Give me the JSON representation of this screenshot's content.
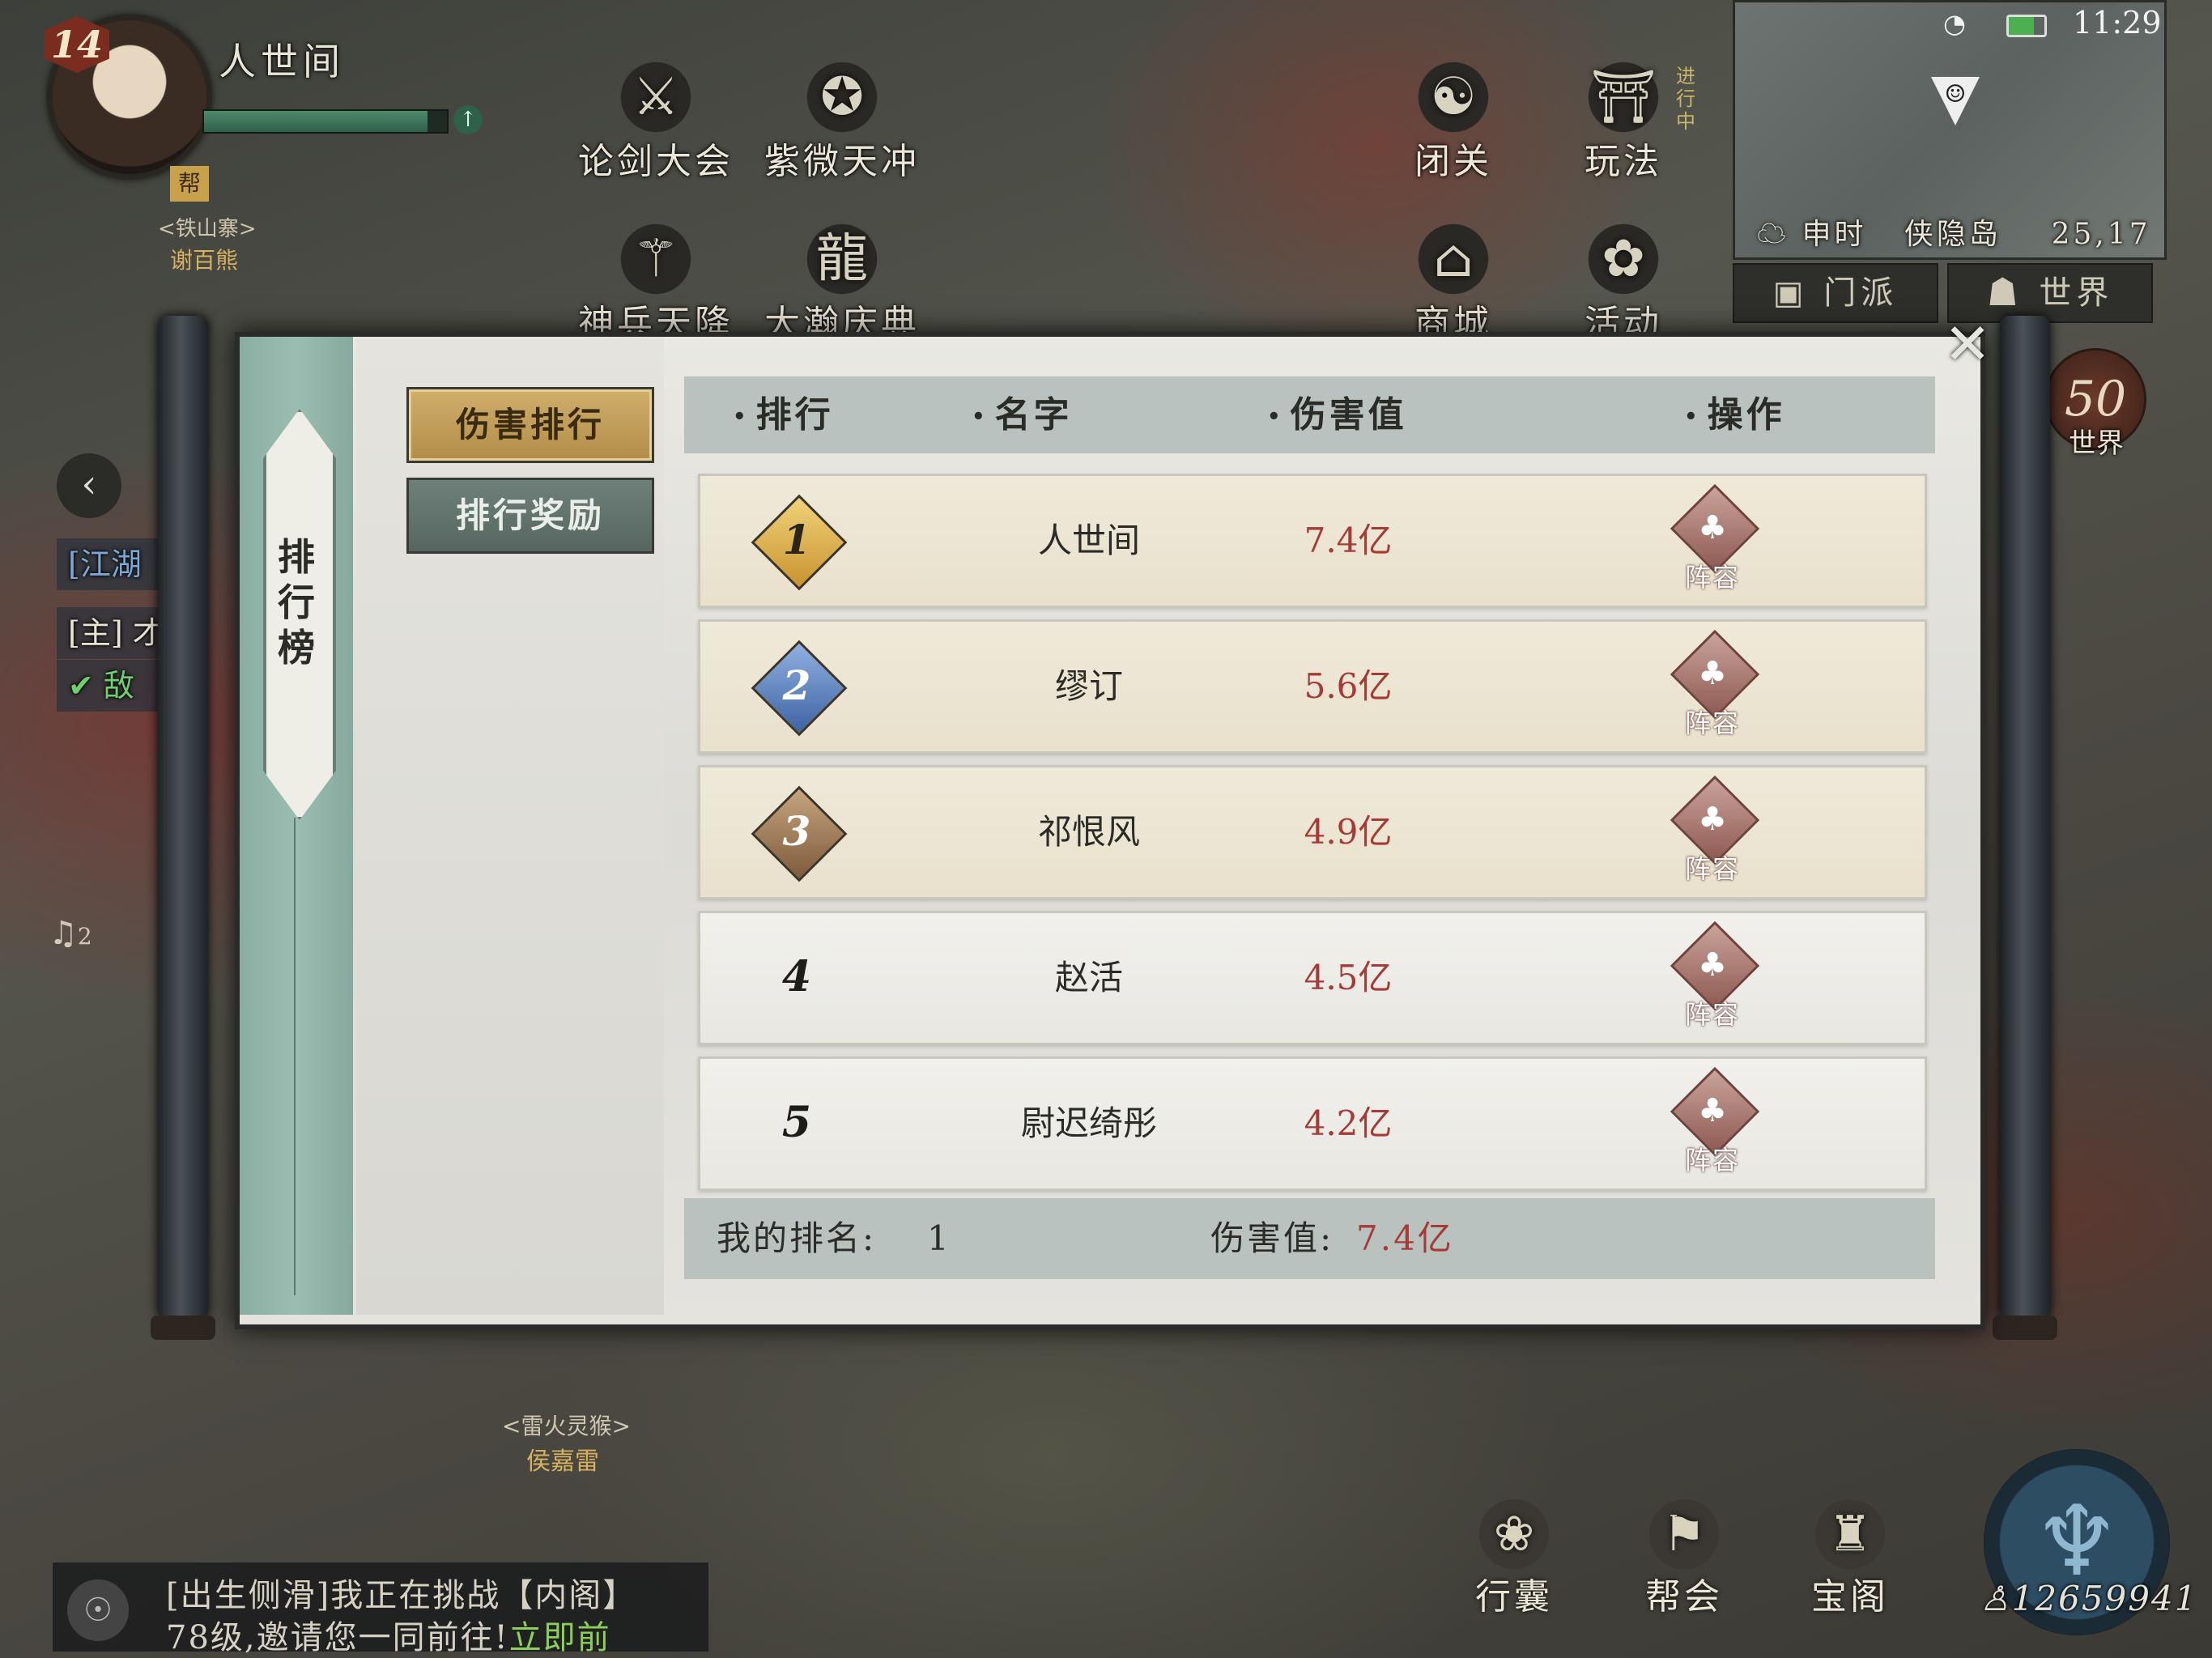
{
  "player": {
    "level": "14",
    "name": "人世间",
    "guild_icon": "帮",
    "guild_name": "<铁山寨>",
    "guild_member": "谢百熊"
  },
  "top_menu": [
    {
      "label": "论剑大会",
      "icon": "crossed-swords-icon",
      "glyph": "⚔"
    },
    {
      "label": "紫微天冲",
      "icon": "scroll-icon",
      "glyph": "✪"
    },
    {
      "label": "神兵天降",
      "icon": "sword-icon",
      "glyph": "⚚"
    },
    {
      "label": "大瀚庆典",
      "icon": "dragon-icon",
      "glyph": "龍"
    },
    {
      "label": "闭关",
      "icon": "meditation-icon",
      "glyph": "☯"
    },
    {
      "label": "玩法",
      "icon": "gate-icon",
      "glyph": "⛩"
    },
    {
      "label": "商城",
      "icon": "shop-icon",
      "glyph": "⌂"
    },
    {
      "label": "活动",
      "icon": "activity-icon",
      "glyph": "✿"
    }
  ],
  "in_progress_note": "进行中",
  "status_bar": {
    "time": "11:29",
    "battery_level": 0.7
  },
  "minimap": {
    "time_period": "申时",
    "location": "侠隐岛",
    "coords": "25,17"
  },
  "map_tabs": {
    "sect": "门派",
    "world": "世界"
  },
  "world_badge": {
    "value": "50",
    "label": "世界"
  },
  "left_chat_tags": [
    "[江湖",
    "[主] 才",
    "✔ 敌"
  ],
  "bell_count": "2",
  "panel": {
    "title": "排行榜",
    "tabs": {
      "damage_rank": "伤害排行",
      "rank_reward": "排行奖励"
    },
    "columns": {
      "rank": "排行",
      "name": "名字",
      "damage": "伤害值",
      "action": "操作"
    },
    "lineup_label": "阵容",
    "rows": [
      {
        "rank": "1",
        "name": "人世间",
        "damage": "7.4亿",
        "medal": "gold"
      },
      {
        "rank": "2",
        "name": "缪订",
        "damage": "5.6亿",
        "medal": "blue"
      },
      {
        "rank": "3",
        "name": "祁恨风",
        "damage": "4.9亿",
        "medal": "bronze"
      },
      {
        "rank": "4",
        "name": "赵活",
        "damage": "4.5亿",
        "medal": "none"
      },
      {
        "rank": "5",
        "name": "尉迟绮彤",
        "damage": "4.2亿",
        "medal": "none"
      }
    ],
    "footer": {
      "my_rank_label": "我的排名:",
      "my_rank_value": "1",
      "damage_label": "伤害值:",
      "damage_value": "7.4亿"
    }
  },
  "npc": {
    "title": "<雷火灵猴>",
    "name": "侯嘉雷"
  },
  "bottom_chat": {
    "line1": "[出生侧滑]我正在挑战【内阁】",
    "line2_prefix": "78级,邀请您一同前往!",
    "line2_link": "立即前"
  },
  "bottom_menu": [
    {
      "label": "行囊",
      "icon": "bag-icon",
      "glyph": "❀"
    },
    {
      "label": "帮会",
      "icon": "flag-icon",
      "glyph": "⚑"
    },
    {
      "label": "宝阁",
      "icon": "treasure-icon",
      "glyph": "♜"
    }
  ],
  "currency": "12659941",
  "colors": {
    "damage_red": "#a63a36",
    "gold_medal": "#d4a43c",
    "blue_medal": "#4f77b5",
    "bronze_medal": "#9a7552",
    "active_tab": "#c6a35e",
    "panel_strip": "#93b5aa"
  }
}
